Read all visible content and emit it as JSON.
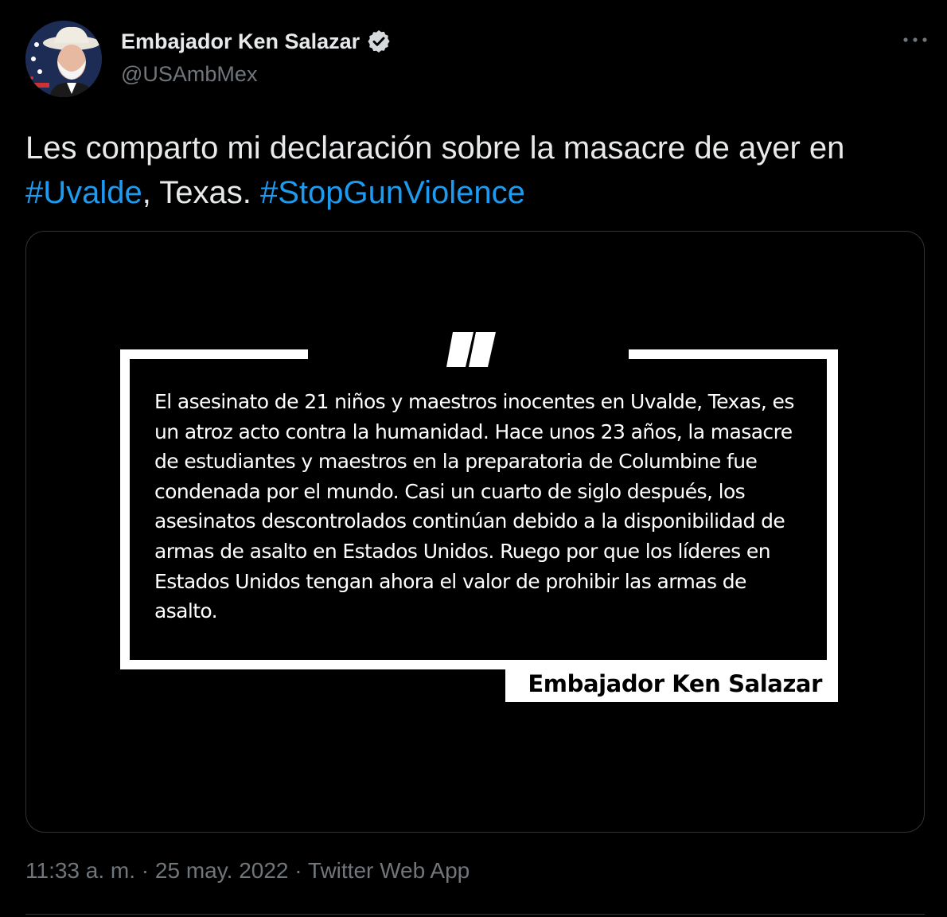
{
  "author": {
    "display_name": "Embajador Ken Salazar",
    "handle": "@USAmbMex",
    "verified_icon": "verified-badge-icon",
    "avatar_icon": "profile-avatar"
  },
  "menu": {
    "icon": "more-options-icon"
  },
  "tweet": {
    "text_part1": "Les comparto mi declaración sobre la masacre de ayer en ",
    "hashtag1": "#Uvalde",
    "text_part2": ", Texas. ",
    "hashtag2": "#StopGunViolence",
    "hashtag_color": "#1d9bf0"
  },
  "media": {
    "quote_mark": "”",
    "statement": "El asesinato de 21 niños y maestros inocentes en Uvalde, Texas, es un atroz acto contra la humanidad. Hace unos 23 años, la masacre de estudiantes y maestros en la preparatoria de Columbine fue condenada por el mundo. Casi un cuarto de siglo después, los asesinatos descontrolados continúan debido a la disponibilidad de armas de asalto en Estados Unidos. Ruego por que los líderes en Estados Unidos tengan ahora el valor de prohibir las armas de asalto.",
    "signature": "Embajador Ken Salazar"
  },
  "meta": {
    "time": "11:33 a. m.",
    "separator": " · ",
    "date": "25 may. 2022",
    "source": "Twitter Web App"
  }
}
